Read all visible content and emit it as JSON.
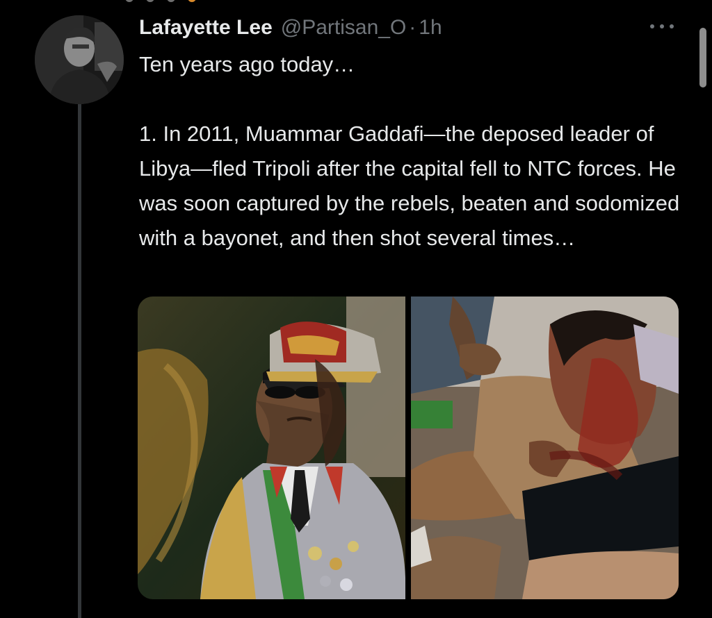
{
  "tweet": {
    "author": {
      "display_name": "Lafayette Lee",
      "handle": "@Partisan_O",
      "separator": "·",
      "timestamp": "1h"
    },
    "text_lines": {
      "line1": "Ten years ago today…",
      "paragraph2": "1. In 2011, Muammar Gaddafi—the deposed leader of Libya—fled Tripoli after the capital fell to NTC forces. He was soon captured by the rebels, beaten and sodomized with a bayonet, and then shot several times…"
    },
    "icons": {
      "more": "more-horizontal-icon",
      "avatar": "avatar"
    },
    "media": [
      {
        "kind": "photo"
      },
      {
        "kind": "photo"
      }
    ]
  },
  "colors": {
    "background": "#000000",
    "primary_text": "#e7e9ea",
    "secondary_text": "#71767b",
    "thread_line": "#333639"
  }
}
